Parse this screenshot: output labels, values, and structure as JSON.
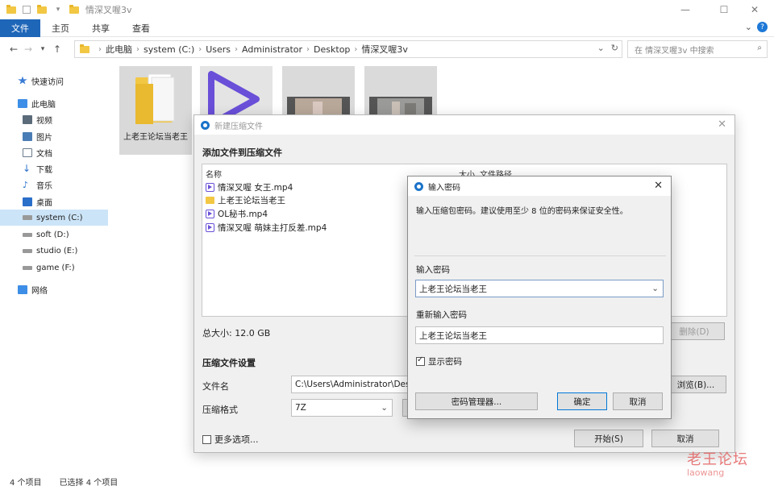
{
  "window": {
    "title": "情深叉喔3v",
    "controls": {
      "minimize": "—",
      "maximize": "☐",
      "close": "✕"
    }
  },
  "ribbon": {
    "tabs": [
      "文件",
      "主页",
      "共享",
      "查看"
    ],
    "expand": "⌄",
    "help": "?"
  },
  "address": {
    "crumbs": [
      "此电脑",
      "system (C:)",
      "Users",
      "Administrator",
      "Desktop",
      "情深叉喔3v"
    ],
    "search_placeholder": "在 情深叉喔3v 中搜索"
  },
  "sidebar": {
    "items": [
      {
        "label": "快速访问",
        "icon": "star-icon",
        "color": "#3a7bd5"
      },
      {
        "label": "此电脑",
        "icon": "pc-icon",
        "color": "#3d8ee6"
      },
      {
        "label": "视频",
        "icon": "video-icon",
        "color": "#5b6b7a"
      },
      {
        "label": "图片",
        "icon": "image-icon",
        "color": "#4a7db5"
      },
      {
        "label": "文档",
        "icon": "document-icon",
        "color": "#6b7c8c"
      },
      {
        "label": "下载",
        "icon": "download-icon",
        "color": "#2a6fc9"
      },
      {
        "label": "音乐",
        "icon": "music-icon",
        "color": "#2a6fc9"
      },
      {
        "label": "桌面",
        "icon": "desktop-icon",
        "color": "#2a6fc9"
      },
      {
        "label": "system (C:)",
        "icon": "drive-icon",
        "color": "#777777"
      },
      {
        "label": "soft (D:)",
        "icon": "drive-icon",
        "color": "#777777"
      },
      {
        "label": "studio (E:)",
        "icon": "drive-icon",
        "color": "#777777"
      },
      {
        "label": "game (F:)",
        "icon": "drive-icon",
        "color": "#777777"
      },
      {
        "label": "网络",
        "icon": "network-icon",
        "color": "#3d8ee6"
      }
    ],
    "selected_index": 8
  },
  "content": {
    "folder_label": "上老王论坛当老王"
  },
  "status": {
    "count": "4 个项目",
    "selected": "已选择 4 个项目"
  },
  "archive_dialog": {
    "title": "新建压缩文件",
    "heading": "添加文件到压缩文件",
    "columns": {
      "name": "名称",
      "size": "大小",
      "path": "文件路径"
    },
    "files": [
      {
        "name": "情深叉喔 女王.mp4",
        "type": "video"
      },
      {
        "name": "上老王论坛当老王",
        "type": "folder"
      },
      {
        "name": "OL秘书.mp4",
        "type": "video"
      },
      {
        "name": "情深叉喔 萌妹主打反差.mp4",
        "type": "video"
      }
    ],
    "total": "总大小: 12.0 GB",
    "delete_button": "删除(D)",
    "settings_heading": "压缩文件设置",
    "filename_label": "文件名",
    "filename_value": "C:\\Users\\Administrator\\Des",
    "browse_button": "浏览(B)...",
    "format_label": "压缩格式",
    "format_value": "7Z",
    "more_options": "更多选项...",
    "start_button": "开始(S)",
    "cancel_button": "取消"
  },
  "password_dialog": {
    "title": "输入密码",
    "description": "输入压缩包密码。建议使用至少 8 位的密码来保证安全性。",
    "password_label": "输入密码",
    "password_value": "上老王论坛当老王",
    "confirm_label": "重新输入密码",
    "confirm_value": "上老王论坛当老王",
    "show_password": "显示密码",
    "show_password_checked": true,
    "manager_button": "密码管理器...",
    "ok_button": "确定",
    "cancel_button": "取消"
  },
  "watermark": {
    "cn": "老王论坛",
    "en": "laowang"
  },
  "colors": {
    "accent": "#1e66b8",
    "video": "#6a4fd8",
    "folder": "#f2c744",
    "watermark": "#e45b5b"
  }
}
